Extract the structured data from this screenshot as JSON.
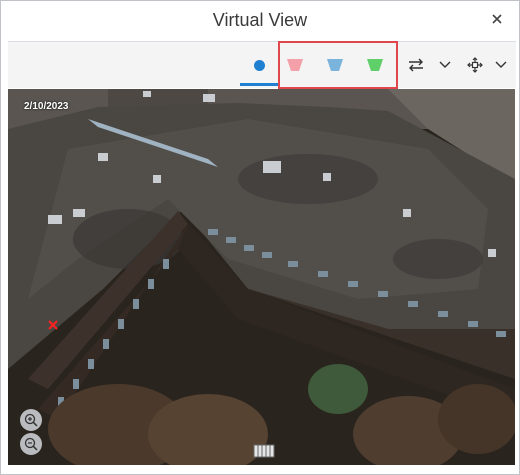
{
  "window": {
    "title": "Virtual View",
    "close_icon": "close-icon"
  },
  "toolbar": {
    "items": [
      {
        "name": "dot-view-button",
        "icon": "blue-dot-icon",
        "color": "#1f7fd1",
        "active": true
      },
      {
        "name": "red-frustum-button",
        "icon": "frustum-icon",
        "color": "#f4a0a8"
      },
      {
        "name": "blue-frustum-button",
        "icon": "frustum-icon",
        "color": "#7ab3db"
      },
      {
        "name": "green-frustum-button",
        "icon": "frustum-icon",
        "color": "#5fcf6a"
      },
      {
        "name": "swap-button",
        "icon": "swap-arrows-icon"
      },
      {
        "name": "swap-dropdown",
        "icon": "chevron-down-icon"
      },
      {
        "name": "navigation-button",
        "icon": "move-cross-icon"
      },
      {
        "name": "navigation-dropdown",
        "icon": "chevron-down-icon"
      }
    ],
    "highlight_color": "#e0474c"
  },
  "viewport": {
    "date": "2/10/2023",
    "marker_icon": "red-x-marker-icon",
    "zoom_in_icon": "zoom-in-icon",
    "zoom_out_icon": "zoom-out-icon",
    "orientation_icon": "building-orientation-icon"
  }
}
